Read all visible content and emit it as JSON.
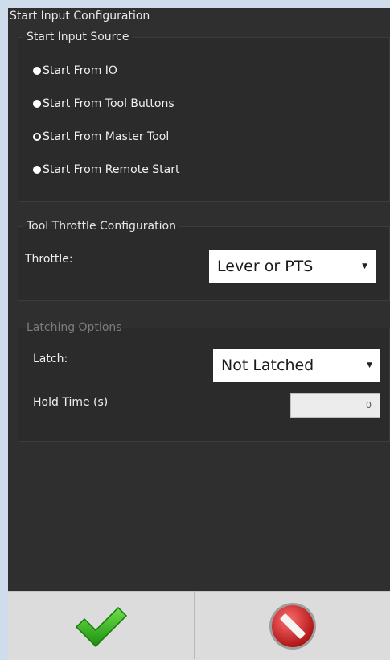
{
  "panel": {
    "title": "Start Input Configuration"
  },
  "start_input_source": {
    "legend": "Start Input Source",
    "options": [
      {
        "label": "Start From IO",
        "selected": false
      },
      {
        "label": "Start From Tool Buttons",
        "selected": false
      },
      {
        "label": "Start From Master Tool",
        "selected": true
      },
      {
        "label": "Start From Remote Start",
        "selected": false
      }
    ]
  },
  "tool_throttle": {
    "legend": "Tool Throttle Configuration",
    "throttle_label": "Throttle:",
    "throttle_value": "Lever or PTS"
  },
  "latching": {
    "legend": "Latching Options",
    "latch_label": "Latch:",
    "latch_value": "Not Latched",
    "hold_time_label": "Hold Time (s)",
    "hold_time_value": "0"
  },
  "colors": {
    "panel_bg": "#2f2f2f",
    "accent_ok": "#2fae1a",
    "accent_cancel": "#cc2222"
  },
  "icons": {
    "confirm": "checkmark-icon",
    "cancel": "cancel-icon"
  }
}
